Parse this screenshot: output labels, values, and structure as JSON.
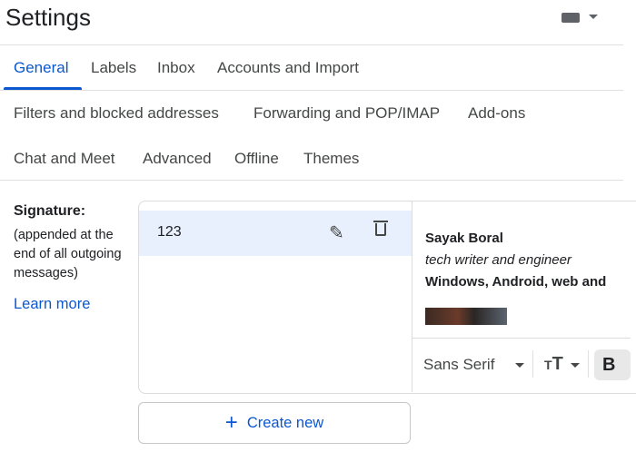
{
  "header": {
    "title": "Settings",
    "input_tools_icon": "keyboard-icon"
  },
  "tabs": [
    {
      "label": "General",
      "active": true
    },
    {
      "label": "Labels"
    },
    {
      "label": "Inbox"
    },
    {
      "label": "Accounts and Import"
    },
    {
      "label": "Filters and blocked addresses"
    },
    {
      "label": "Forwarding and POP/IMAP"
    },
    {
      "label": "Add-ons"
    },
    {
      "label": "Chat and Meet"
    },
    {
      "label": "Advanced"
    },
    {
      "label": "Offline"
    },
    {
      "label": "Themes"
    }
  ],
  "signature": {
    "label": "Signature:",
    "description": "(appended at the end of all outgoing messages)",
    "learn_more": "Learn more",
    "items": [
      {
        "name": "123"
      }
    ],
    "preview": {
      "name": "Sayak Boral",
      "role": "tech writer and engineer",
      "topics": "Windows, Android, web and"
    },
    "toolbar": {
      "font": "Sans Serif",
      "bold": "B"
    },
    "create_new": "Create new"
  },
  "colors": {
    "accent": "#0b57d0",
    "selected": "#e8f0fe"
  }
}
